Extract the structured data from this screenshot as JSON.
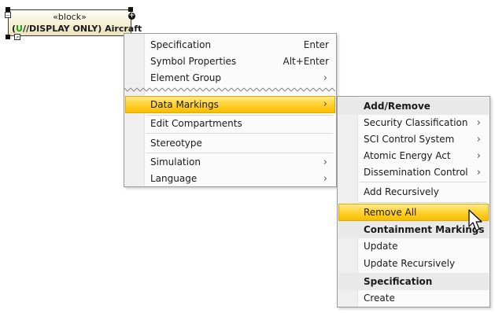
{
  "block": {
    "stereotype": "«block»",
    "name_prefix": "(",
    "name_marker": "U",
    "name_rest": "//DISPLAY ONLY) Aircraft"
  },
  "menu1": {
    "items": [
      {
        "label": "Specification",
        "accel": "Enter"
      },
      {
        "label": "Symbol Properties",
        "accel": "Alt+Enter"
      },
      {
        "label": "Element Group",
        "submenu": true
      },
      {
        "label": "Data Markings",
        "submenu": true,
        "highlighted": true
      },
      {
        "label": "Edit Compartments"
      },
      {
        "label": "Stereotype"
      },
      {
        "label": "Simulation",
        "submenu": true
      },
      {
        "label": "Language",
        "submenu": true
      }
    ]
  },
  "menu2": {
    "header_add_remove": "Add/Remove",
    "items_group1": [
      {
        "label": "Security Classification",
        "submenu": true
      },
      {
        "label": "SCI Control System",
        "submenu": true
      },
      {
        "label": "Atomic Energy Act",
        "submenu": true
      },
      {
        "label": "Dissemination Control",
        "submenu": true
      }
    ],
    "add_recursively": "Add Recursively",
    "remove_all": "Remove All",
    "header_containment": "Containment Markings",
    "update": "Update",
    "update_recursively": "Update Recursively",
    "header_specification": "Specification",
    "create": "Create"
  },
  "colors": {
    "highlight": "#ffd02a",
    "highlight_border": "#e0a800",
    "marker_green": "#1e9e1e"
  },
  "icons": {
    "submenu_arrow": "›",
    "cursor": "arrow-cursor-icon"
  }
}
